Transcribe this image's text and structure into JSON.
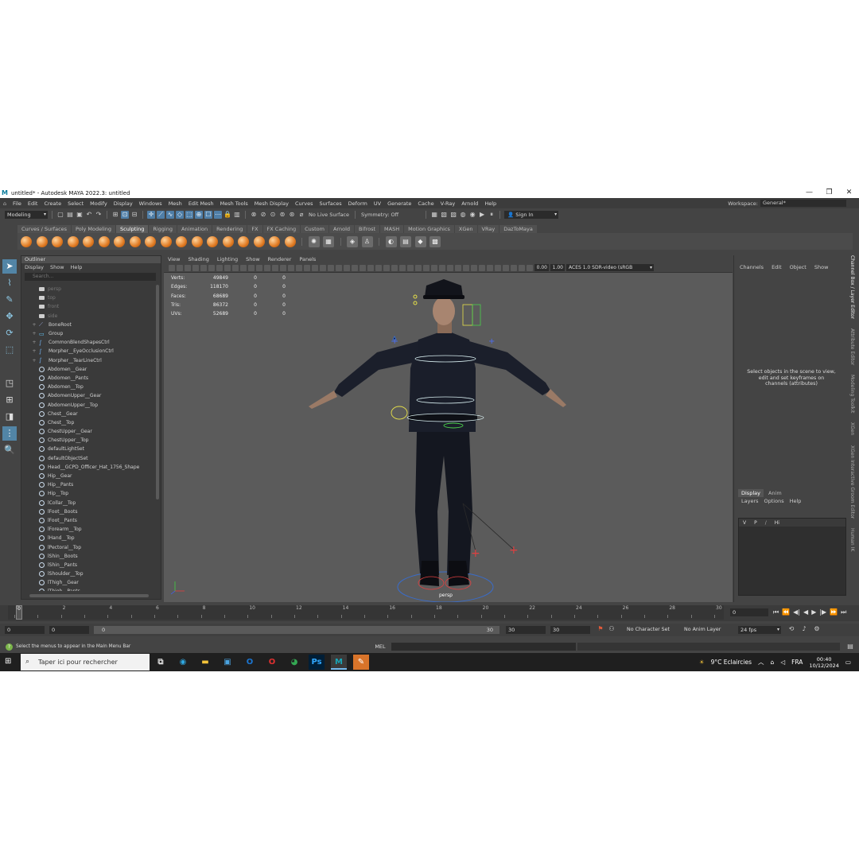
{
  "window": {
    "title": "untitled* - Autodesk MAYA 2022.3: untitled",
    "logo": "M",
    "controls": [
      "—",
      "❐",
      "✕"
    ]
  },
  "menubar": {
    "items": [
      "File",
      "Edit",
      "Create",
      "Select",
      "Modify",
      "Display",
      "Windows",
      "Mesh",
      "Edit Mesh",
      "Mesh Tools",
      "Mesh Display",
      "Curves",
      "Surfaces",
      "Deform",
      "UV",
      "Generate",
      "Cache",
      "V-Ray",
      "Arnold",
      "Help"
    ],
    "workspace_label": "Workspace:",
    "workspace_value": "General*"
  },
  "statusline": {
    "mode": "Modeling",
    "live_surface": "No Live Surface",
    "symmetry": "Symmetry: Off",
    "sign_in": "Sign In"
  },
  "shelf": {
    "tabs": [
      "Curves / Surfaces",
      "Poly Modeling",
      "Sculpting",
      "Rigging",
      "Animation",
      "Rendering",
      "FX",
      "FX Caching",
      "Custom",
      "Arnold",
      "Bifrost",
      "MASH",
      "Motion Graphics",
      "XGen",
      "VRay",
      "DazToMaya"
    ],
    "active_tab": "Sculpting",
    "sculpt_tool_count": 18
  },
  "outliner": {
    "title": "Outliner",
    "menu": [
      "Display",
      "Show",
      "Help"
    ],
    "search_placeholder": "Search...",
    "items": [
      {
        "label": "persp",
        "icon": "camera-icon",
        "dim": true,
        "expand": ""
      },
      {
        "label": "top",
        "icon": "camera-icon",
        "dim": true,
        "expand": ""
      },
      {
        "label": "front",
        "icon": "camera-icon",
        "dim": true,
        "expand": ""
      },
      {
        "label": "side",
        "icon": "camera-icon",
        "dim": true,
        "expand": ""
      },
      {
        "label": "BoneRoot",
        "icon": "joint-icon",
        "dim": false,
        "expand": "+"
      },
      {
        "label": "Group",
        "icon": "group-icon",
        "dim": false,
        "expand": "+"
      },
      {
        "label": "CommonBlendShapesCtrl",
        "icon": "curve-icon",
        "dim": false,
        "expand": "+"
      },
      {
        "label": "Morpher__EyeOcclusionCtrl",
        "icon": "curve-icon",
        "dim": false,
        "expand": "+"
      },
      {
        "label": "Morpher__TearLineCtrl",
        "icon": "curve-icon",
        "dim": false,
        "expand": "+"
      },
      {
        "label": "Abdomen__Gear",
        "icon": "mesh-icon",
        "dim": false,
        "expand": ""
      },
      {
        "label": "Abdomen__Pants",
        "icon": "mesh-icon",
        "dim": false,
        "expand": ""
      },
      {
        "label": "Abdomen__Top",
        "icon": "mesh-icon",
        "dim": false,
        "expand": ""
      },
      {
        "label": "AbdomenUpper__Gear",
        "icon": "mesh-icon",
        "dim": false,
        "expand": ""
      },
      {
        "label": "AbdomenUpper__Top",
        "icon": "mesh-icon",
        "dim": false,
        "expand": ""
      },
      {
        "label": "Chest__Gear",
        "icon": "mesh-icon",
        "dim": false,
        "expand": ""
      },
      {
        "label": "Chest__Top",
        "icon": "mesh-icon",
        "dim": false,
        "expand": ""
      },
      {
        "label": "ChestUpper__Gear",
        "icon": "mesh-icon",
        "dim": false,
        "expand": ""
      },
      {
        "label": "ChestUpper__Top",
        "icon": "mesh-icon",
        "dim": false,
        "expand": ""
      },
      {
        "label": "defaultLightSet",
        "icon": "mesh-icon",
        "dim": false,
        "expand": ""
      },
      {
        "label": "defaultObjectSet",
        "icon": "mesh-icon",
        "dim": false,
        "expand": ""
      },
      {
        "label": "Head__GCPD_Officer_Hat_1756_Shape",
        "icon": "mesh-icon",
        "dim": false,
        "expand": ""
      },
      {
        "label": "Hip__Gear",
        "icon": "mesh-icon",
        "dim": false,
        "expand": ""
      },
      {
        "label": "Hip__Pants",
        "icon": "mesh-icon",
        "dim": false,
        "expand": ""
      },
      {
        "label": "Hip__Top",
        "icon": "mesh-icon",
        "dim": false,
        "expand": ""
      },
      {
        "label": "lCollar__Top",
        "icon": "mesh-icon",
        "dim": false,
        "expand": ""
      },
      {
        "label": "lFoot__Boots",
        "icon": "mesh-icon",
        "dim": false,
        "expand": ""
      },
      {
        "label": "lFoot__Pants",
        "icon": "mesh-icon",
        "dim": false,
        "expand": ""
      },
      {
        "label": "lForearm__Top",
        "icon": "mesh-icon",
        "dim": false,
        "expand": ""
      },
      {
        "label": "lHand__Top",
        "icon": "mesh-icon",
        "dim": false,
        "expand": ""
      },
      {
        "label": "lPectoral__Top",
        "icon": "mesh-icon",
        "dim": false,
        "expand": ""
      },
      {
        "label": "lShin__Boots",
        "icon": "mesh-icon",
        "dim": false,
        "expand": ""
      },
      {
        "label": "lShin__Pants",
        "icon": "mesh-icon",
        "dim": false,
        "expand": ""
      },
      {
        "label": "lShoulder__Top",
        "icon": "mesh-icon",
        "dim": false,
        "expand": ""
      },
      {
        "label": "lThigh__Gear",
        "icon": "mesh-icon",
        "dim": false,
        "expand": ""
      },
      {
        "label": "lThigh__Pants",
        "icon": "mesh-icon",
        "dim": false,
        "expand": ""
      }
    ]
  },
  "viewport": {
    "menu": [
      "View",
      "Shading",
      "Lighting",
      "Show",
      "Renderer",
      "Panels"
    ],
    "exposure": "0.00",
    "gamma": "1.00",
    "colorspace": "ACES 1.0 SDR-video (sRGB",
    "camera": "persp",
    "hud": [
      {
        "label": "Verts:",
        "value": "49849",
        "a": "0",
        "b": "0"
      },
      {
        "label": "Edges:",
        "value": "118170",
        "a": "0",
        "b": "0"
      },
      {
        "label": "Faces:",
        "value": "68689",
        "a": "0",
        "b": "0"
      },
      {
        "label": "Tris:",
        "value": "86372",
        "a": "0",
        "b": "0"
      },
      {
        "label": "UVs:",
        "value": "52689",
        "a": "0",
        "b": "0"
      }
    ]
  },
  "channelbox": {
    "menu": [
      "Channels",
      "Edit",
      "Object",
      "Show"
    ],
    "hint": "Select objects in the scene to view, edit and set keyframes on channels (attributes)",
    "layer_tabs": [
      "Display",
      "Anim"
    ],
    "layer_menu": [
      "Layers",
      "Options",
      "Help"
    ],
    "layer": {
      "v": "V",
      "p": "P",
      "name": "Hi"
    },
    "side_tabs": [
      "Channel Box / Layer Editor",
      "Attribute Editor",
      "Modeling Toolkit",
      "XGen",
      "XGen Interactive Groom Editor",
      "Human IK"
    ]
  },
  "timeslider": {
    "ticks": [
      "0",
      "2",
      "4",
      "6",
      "8",
      "10",
      "12",
      "14",
      "16",
      "18",
      "20",
      "22",
      "24",
      "26",
      "28",
      "30",
      "5",
      "7",
      "9",
      "11",
      "13",
      "15",
      "17",
      "19",
      "21",
      "23",
      "25",
      "27",
      "29"
    ],
    "major": [
      "0",
      "2",
      "4",
      "6",
      "8",
      "10",
      "12",
      "14",
      "16",
      "18",
      "20",
      "22",
      "24",
      "26",
      "28",
      "30"
    ],
    "current_frame": "0",
    "playhead_label": "0",
    "playback_icons": [
      "⏮",
      "⏪",
      "◀|",
      "◀",
      "▶",
      "|▶",
      "⏩",
      "⏭"
    ]
  },
  "rangeslider": {
    "start": "0",
    "anim_start": "0",
    "range_start": "0",
    "range_end": "30",
    "anim_end": "30",
    "end": "30",
    "character_set": "No Character Set",
    "anim_layer": "No Anim Layer",
    "fps": "24 fps"
  },
  "cmdline": {
    "help_text": "Select the menus to appear in the Main Menu Bar",
    "language": "MEL"
  },
  "taskbar": {
    "search_placeholder": "Taper ici pour rechercher",
    "weather": "9°C  Eclaircies",
    "lang": "FRA",
    "time": "00:40",
    "date": "10/12/2024"
  },
  "colors": {
    "maya_bg": "#444444",
    "viewport_bg": "#5b5b5b",
    "accent_blue": "#5285a6",
    "sculpt_orange": "#e07a22"
  }
}
